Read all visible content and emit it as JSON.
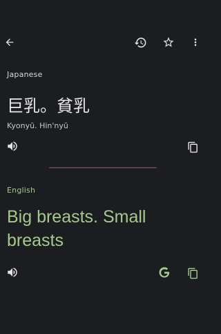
{
  "source": {
    "language": "Japanese",
    "text": "巨乳。貧乳",
    "transliteration": "Kyonyū. Hin'nyū"
  },
  "target": {
    "language": "English",
    "text": "Big breasts. Small breasts"
  },
  "icons": {
    "back": "arrow-left",
    "history": "history",
    "star": "star-outline",
    "more": "more-vert",
    "speaker": "volume-up",
    "copy": "copy",
    "google": "google-g"
  },
  "colors": {
    "background": "#1c1d20",
    "icon": "#e3e3e3",
    "source_label": "#d8d8d8",
    "target_label": "#a4c98c",
    "target_text": "#a4c98c",
    "divider": "#5a4048"
  }
}
